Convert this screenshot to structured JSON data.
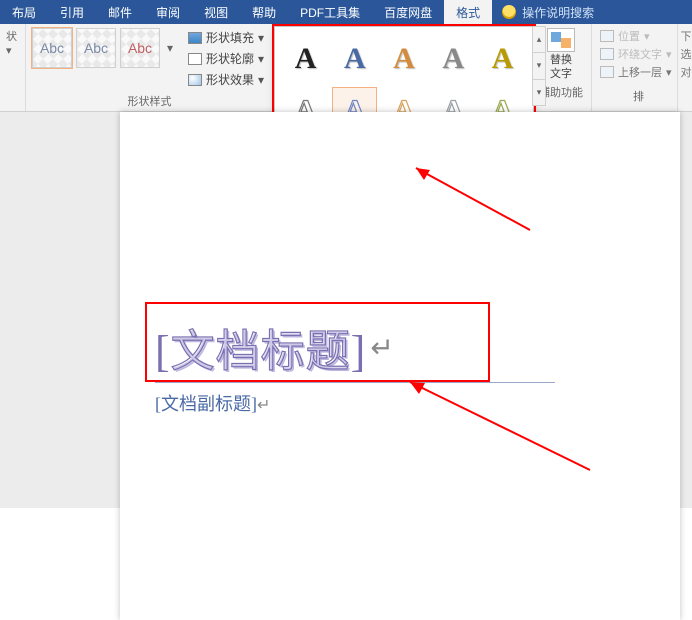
{
  "tabs": {
    "items": [
      "布局",
      "引用",
      "邮件",
      "审阅",
      "视图",
      "帮助",
      "PDF工具集",
      "百度网盘",
      "格式"
    ],
    "active_index": 8,
    "tellme": "操作说明搜索"
  },
  "ribbon": {
    "shape_chip_label": "Abc",
    "shape_arrow_glyph": "▾",
    "shape_fill": "形状填充",
    "shape_outline": "形状轮廓",
    "shape_effects": "形状效果",
    "shape_group_label": "形状样式",
    "wordart_letter": "A",
    "alt_text_line1": "替换",
    "alt_text_line2": "文字",
    "alt_text_group": "辅助功能",
    "pos": "位置",
    "wrap": "环绕文字",
    "bring_forward": "上移一层",
    "arrange_group": "排",
    "right_col": {
      "a": "下",
      "b": "选",
      "c": "对"
    }
  },
  "gallery": {
    "colors": [
      [
        "#222",
        "#4a6aa5",
        "#d38b3d",
        "#888",
        "#b79b00"
      ],
      [
        "#777",
        "#6f86c7",
        "#d9a25c",
        "#9aa0a6",
        "#9aa84f"
      ],
      [
        "#111",
        "#2f5ccc",
        "#4aa3a3",
        "#c05050",
        "#bcbcbc"
      ]
    ],
    "selected": [
      1,
      1
    ]
  },
  "document": {
    "title_open": "[",
    "title_text": "文档标题",
    "title_close": "]",
    "para_mark": "↵",
    "subtitle": "[文档副标题]"
  }
}
